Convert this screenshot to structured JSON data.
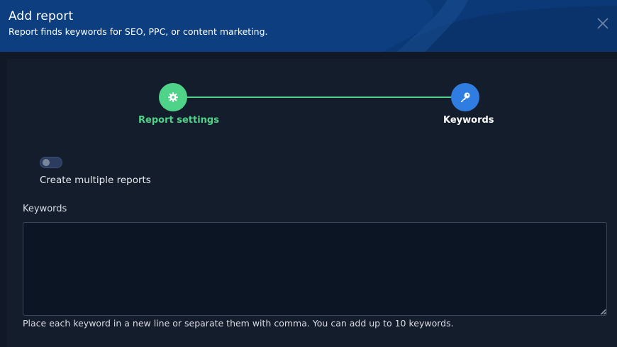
{
  "header": {
    "title": "Add report",
    "subtitle": "Report finds keywords for SEO, PPC, or content marketing.",
    "close_icon": "close-icon",
    "background_color": "#0d3f80"
  },
  "stepper": {
    "steps": [
      {
        "label": "Report settings",
        "icon": "gear-icon",
        "color": "#4fd389",
        "state": "completed"
      },
      {
        "label": "Keywords",
        "icon": "key-icon",
        "color": "#2f7de1",
        "state": "active"
      }
    ],
    "connector_color": "#4fd389"
  },
  "multiple_reports": {
    "label": "Create multiple reports",
    "enabled": false
  },
  "keywords": {
    "label": "Keywords",
    "value": "",
    "help_text": "Place each keyword in a new line or separate them with comma. You can add up to 10 keywords."
  }
}
